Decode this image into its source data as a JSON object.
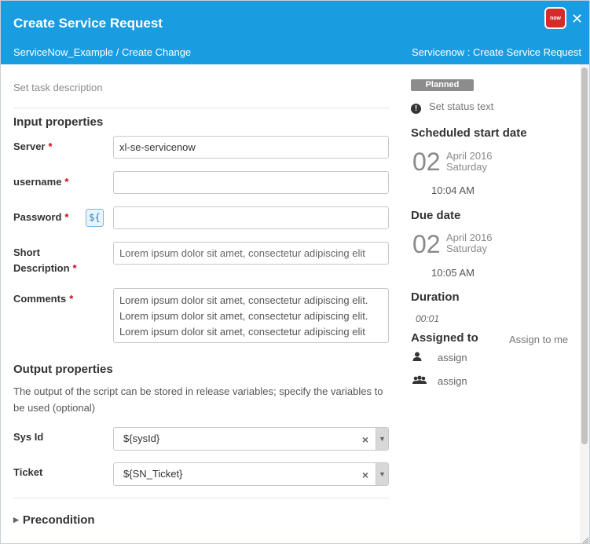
{
  "dialog": {
    "title": "Create Service Request",
    "breadcrumb": "ServiceNow_Example / Create Change",
    "task_type": "Servicenow : Create Service Request",
    "logo_text": "now"
  },
  "task": {
    "description_placeholder": "Set task description"
  },
  "input_properties": {
    "title": "Input properties",
    "server": {
      "label": "Server",
      "value": "xl-se-servicenow"
    },
    "username": {
      "label": "username",
      "value": ""
    },
    "password": {
      "label": "Password",
      "value": "",
      "variable_button": "${"
    },
    "short_description": {
      "label_line1": "Short",
      "label_line2": "Description",
      "value": "Lorem ipsum dolor sit amet, consectetur adipiscing elit"
    },
    "comments": {
      "label": "Comments",
      "lines": [
        "Lorem ipsum dolor sit amet, consectetur adipiscing elit.",
        "Lorem ipsum dolor sit amet, consectetur adipiscing elit.",
        "Lorem ipsum dolor sit amet, consectetur adipiscing elit"
      ]
    },
    "required_marker": "*"
  },
  "output_properties": {
    "title": "Output properties",
    "help_text": "The output of the script can be stored in release variables; specify the variables to be used (optional)",
    "sys_id": {
      "label": "Sys Id",
      "value": "${sysId}"
    },
    "ticket": {
      "label": "Ticket",
      "value": "${SN_Ticket}"
    }
  },
  "precondition": {
    "label": "Precondition"
  },
  "sidebar": {
    "status_badge": "Planned",
    "status_text": "Set status text",
    "scheduled_start": {
      "title": "Scheduled start date",
      "day": "02",
      "month_year": "April 2016",
      "weekday": "Saturday",
      "time": "10:04 AM"
    },
    "due": {
      "title": "Due date",
      "day": "02",
      "month_year": "April 2016",
      "weekday": "Saturday",
      "time": "10:05 AM"
    },
    "duration": {
      "title": "Duration",
      "value": "00:01"
    },
    "assigned": {
      "title": "Assigned to",
      "assign_to_me": "Assign to me",
      "user_assign": "assign",
      "team_assign": "assign"
    }
  },
  "icons": {
    "close": "close-icon",
    "status": "exclamation-circle-icon",
    "user": "user-icon",
    "team": "team-icon",
    "clear": "clear-icon",
    "dropdown": "caret-down-icon",
    "expand": "caret-right-icon"
  },
  "colors": {
    "header": "#1a9ce0",
    "required": "#d0021b",
    "badge": "#8c8c8c",
    "logo": "#d52b2b"
  }
}
